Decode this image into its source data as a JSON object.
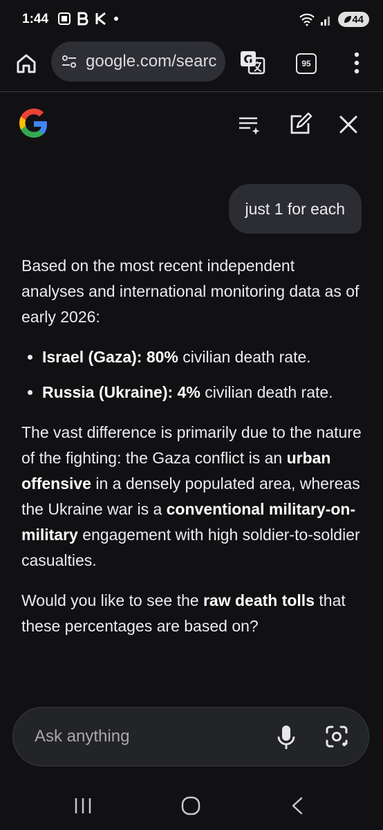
{
  "status_bar": {
    "time": "1:44",
    "left_icons": [
      "screenshot-icon",
      "b-app-icon",
      "k-app-icon",
      "dot-icon"
    ],
    "battery": "44"
  },
  "browser": {
    "url": "google.com/searc",
    "tab_count": "95"
  },
  "header": {
    "icons": [
      "logo-google-g",
      "history-sparkle-icon",
      "new-chat-icon",
      "close-icon"
    ]
  },
  "conversation": {
    "user_message": "just 1 for each",
    "answer": {
      "intro": "Based on the most recent independent analyses and international monitoring data as of early 2026:",
      "bullets": [
        {
          "label": "Israel (Gaza): 80%",
          "rest": " civilian death rate."
        },
        {
          "label": "Russia (Ukraine): 4%",
          "rest": " civilian death rate."
        }
      ],
      "para2": {
        "t1": "The vast difference is primarily due to the nature of the fighting: the Gaza conflict is an ",
        "b1": "urban offensive",
        "t2": " in a densely populated area, whereas the Ukraine war is a ",
        "b2": "conventional military-on-military",
        "t3": " engagement with high soldier-to-soldier casualties."
      },
      "para3": {
        "t1": "Would you like to see the ",
        "b1": "raw death tolls",
        "t2": " that these percentages are based on?"
      }
    }
  },
  "ask_bar": {
    "placeholder": "Ask anything"
  },
  "colors": {
    "background": "#111114",
    "bubble": "#2c2d33",
    "url_box": "#2e2f35"
  }
}
